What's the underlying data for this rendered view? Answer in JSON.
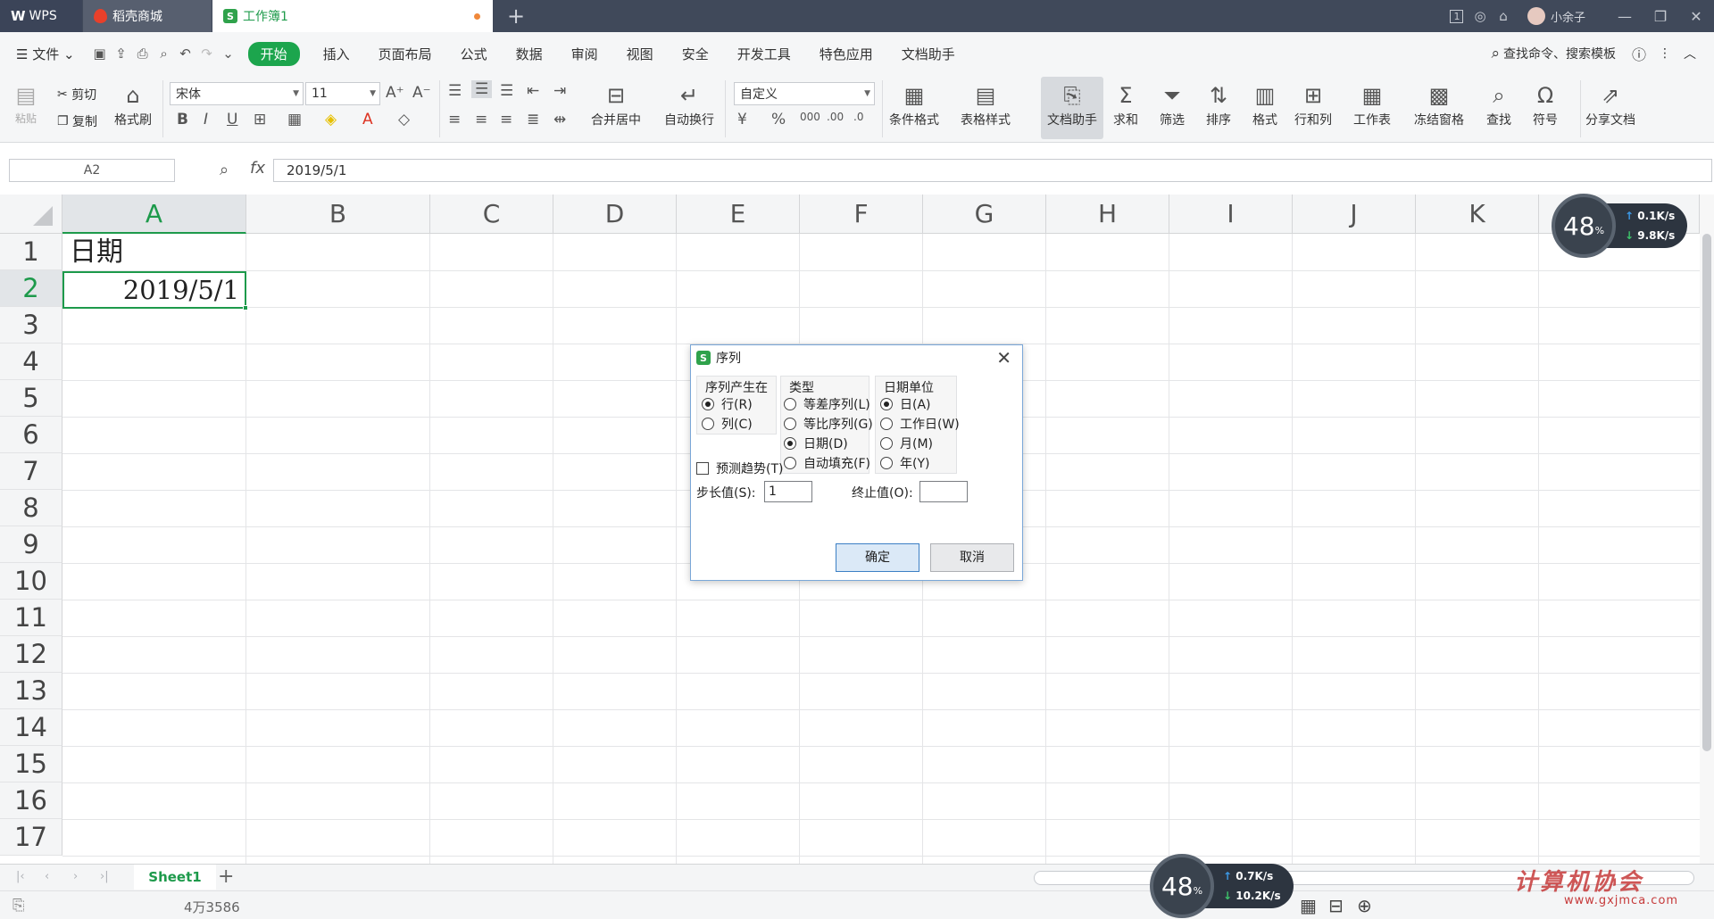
{
  "titlebar": {
    "tabs": [
      {
        "label": "WPS",
        "logo": "W"
      },
      {
        "label": "稻壳商城"
      },
      {
        "label": "工作簿1",
        "icon_text": "S"
      }
    ],
    "new_tab_label": "+",
    "window_count": "1",
    "user_name": "小余子"
  },
  "menu": {
    "file_label": "文件",
    "items": [
      "开始",
      "插入",
      "页面布局",
      "公式",
      "数据",
      "审阅",
      "视图",
      "安全",
      "开发工具",
      "特色应用",
      "文档助手"
    ],
    "search_label": "查找命令、搜索模板"
  },
  "ribbon": {
    "paste": "粘贴",
    "cut": "剪切",
    "copy": "复制",
    "format_painter": "格式刷",
    "font_name": "宋体",
    "font_size": "11",
    "merge_center": "合并居中",
    "wrap_text": "自动换行",
    "number_format": "自定义",
    "conditional_format": "条件格式",
    "table_style": "表格样式",
    "doc_helper": "文档助手",
    "sum": "求和",
    "filter": "筛选",
    "sort": "排序",
    "format": "格式",
    "row_col": "行和列",
    "worksheet": "工作表",
    "freeze": "冻结窗格",
    "find": "查找",
    "symbol": "符号",
    "share": "分享文档"
  },
  "formula_bar": {
    "name_box": "A2",
    "fx_label": "fx",
    "value": "2019/5/1"
  },
  "grid": {
    "columns": [
      "A",
      "B",
      "C",
      "D",
      "E",
      "F",
      "G",
      "H",
      "I",
      "J",
      "K"
    ],
    "rows": [
      "1",
      "2",
      "3",
      "4",
      "5",
      "6",
      "7",
      "8",
      "9",
      "10",
      "11",
      "12",
      "13",
      "14",
      "15",
      "16",
      "17"
    ],
    "cells": {
      "A1": "日期",
      "A2": "2019/5/1"
    },
    "selected_cell": "A2"
  },
  "sheets": {
    "tabs": [
      "Sheet1"
    ],
    "add_label": "+"
  },
  "status": {
    "text": "4万3586"
  },
  "network_widgets": [
    {
      "percent": "48",
      "percent_unit": "%",
      "up": "0.1K/s",
      "down": "9.8K/s"
    },
    {
      "percent": "48",
      "percent_unit": "%",
      "up": "0.7K/s",
      "down": "10.2K/s"
    }
  ],
  "watermark": {
    "text": "计算机协会",
    "url": "www.gxjmca.com"
  },
  "dialog": {
    "title": "序列",
    "series_in": {
      "label": "序列产生在",
      "options": [
        "行(R)",
        "列(C)"
      ],
      "selected": "行(R)"
    },
    "type": {
      "label": "类型",
      "options": [
        "等差序列(L)",
        "等比序列(G)",
        "日期(D)",
        "自动填充(F)"
      ],
      "selected": "日期(D)"
    },
    "date_unit": {
      "label": "日期单位",
      "options": [
        "日(A)",
        "工作日(W)",
        "月(M)",
        "年(Y)"
      ],
      "selected": "日(A)"
    },
    "trend_label": "预测趋势(T)",
    "trend_checked": false,
    "step_label": "步长值(S):",
    "step_value": "1",
    "stop_label": "终止值(O):",
    "stop_value": "",
    "ok_label": "确定",
    "cancel_label": "取消"
  }
}
